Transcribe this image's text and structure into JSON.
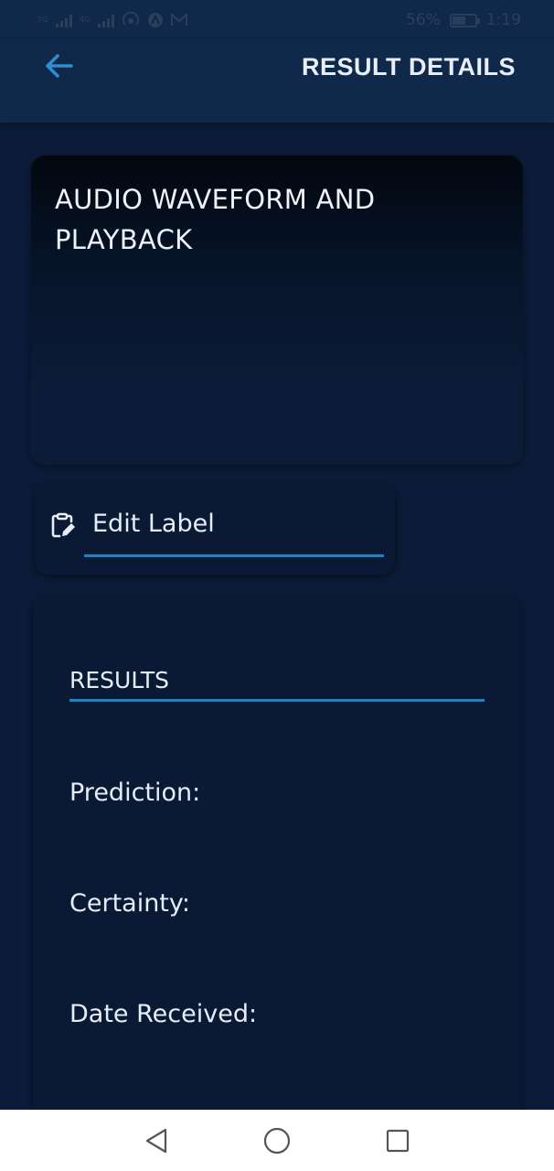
{
  "status_bar": {
    "net_left": "3G",
    "net_right": "4G",
    "battery_percent": "56%",
    "time": "1:19",
    "battery_level": 0.56
  },
  "app_bar": {
    "title": "RESULT DETAILS"
  },
  "waveform": {
    "title": "AUDIO WAVEFORM AND PLAYBACK"
  },
  "edit_label": {
    "placeholder": "Edit Label"
  },
  "results": {
    "heading": "RESULTS",
    "prediction_label": "Prediction:",
    "certainty_label": "Certainty:",
    "date_label": "Date Received:"
  },
  "colors": {
    "background": "#0c1c38",
    "app_bar": "#10284a",
    "accent": "#2b7fb4",
    "back_arrow": "#2e8fd0"
  },
  "icons": {
    "back": "arrow-left-icon",
    "edit": "clipboard-edit-icon",
    "nav_back": "triangle-back-icon",
    "nav_home": "circle-home-icon",
    "nav_recents": "square-recents-icon"
  }
}
